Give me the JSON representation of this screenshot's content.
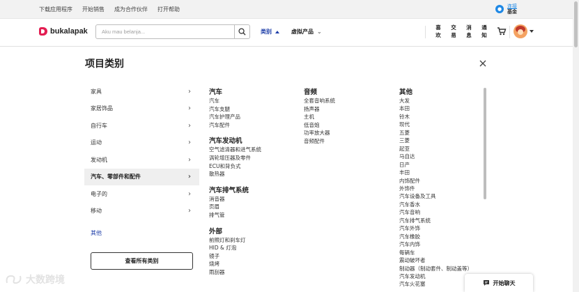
{
  "topbar": {
    "links": [
      "下载应用程序",
      "开始销售",
      "成为合作伙伴",
      "打开帮助"
    ],
    "connect_link": "连接",
    "connect_sub": "基金"
  },
  "header": {
    "logo_text": "bukalapak",
    "search_placeholder": "Aku mau belanja...",
    "nav_category": "类别",
    "nav_virtual": "虚拟产品",
    "vertical_links": [
      [
        "喜",
        "欢"
      ],
      [
        "交",
        "易"
      ],
      [
        "消",
        "息"
      ],
      [
        "通",
        "知"
      ]
    ]
  },
  "panel": {
    "title": "项目类别",
    "categories": [
      {
        "label": "家具",
        "active": false
      },
      {
        "label": "家居饰品",
        "active": false
      },
      {
        "label": "自行车",
        "active": false
      },
      {
        "label": "运动",
        "active": false
      },
      {
        "label": "发动机",
        "active": false
      },
      {
        "label": "汽车、零部件和配件",
        "active": true
      },
      {
        "label": "电子的",
        "active": false
      },
      {
        "label": "移动",
        "active": false
      }
    ],
    "others_label": "其他",
    "see_all_label": "查看所有类别"
  },
  "columns": {
    "col1": [
      {
        "title": "汽车",
        "items": [
          "汽车",
          "汽车支腿",
          "汽车护理产品",
          "汽车配件"
        ]
      },
      {
        "title": "汽车发动机",
        "items": [
          "空气滤清器和进气系统",
          "涡轮增压器及零件",
          "ECU和背负式",
          "散热器"
        ]
      },
      {
        "title": "汽车排气系统",
        "items": [
          "消音器",
          "页眉",
          "排气管"
        ]
      },
      {
        "title": "外部",
        "items": [
          "前照灯和刹车灯",
          "HID & 灯泡",
          "镜子",
          "烧烤",
          "雨刮器"
        ]
      }
    ],
    "col2": [
      {
        "title": "音频",
        "items": [
          "全套音响系统",
          "扬声器",
          "主机",
          "低音炮",
          "功率放大器",
          "音频配件"
        ]
      }
    ],
    "col3": [
      {
        "title": "其他",
        "items": [
          "大发",
          "本田",
          "铃木",
          "现代",
          "五菱",
          "三菱",
          "起亚",
          "马自达",
          "日产",
          "丰田",
          "内饰配件",
          "外饰件",
          "汽车设备及工具",
          "汽车香水",
          "汽车音响",
          "汽车排气系统",
          "汽车外饰",
          "汽车橡胶",
          "汽车内饰",
          "每辆车",
          "震动破坏者",
          "制动器（制动套件、制动盖等）",
          "汽车发动机",
          "汽车火花塞"
        ]
      }
    ]
  },
  "chat": {
    "label": "开始聊天"
  },
  "watermark": {
    "text": "大数跨境"
  },
  "colors": {
    "accent": "#1e3ea8",
    "brand": "#e31e52"
  }
}
